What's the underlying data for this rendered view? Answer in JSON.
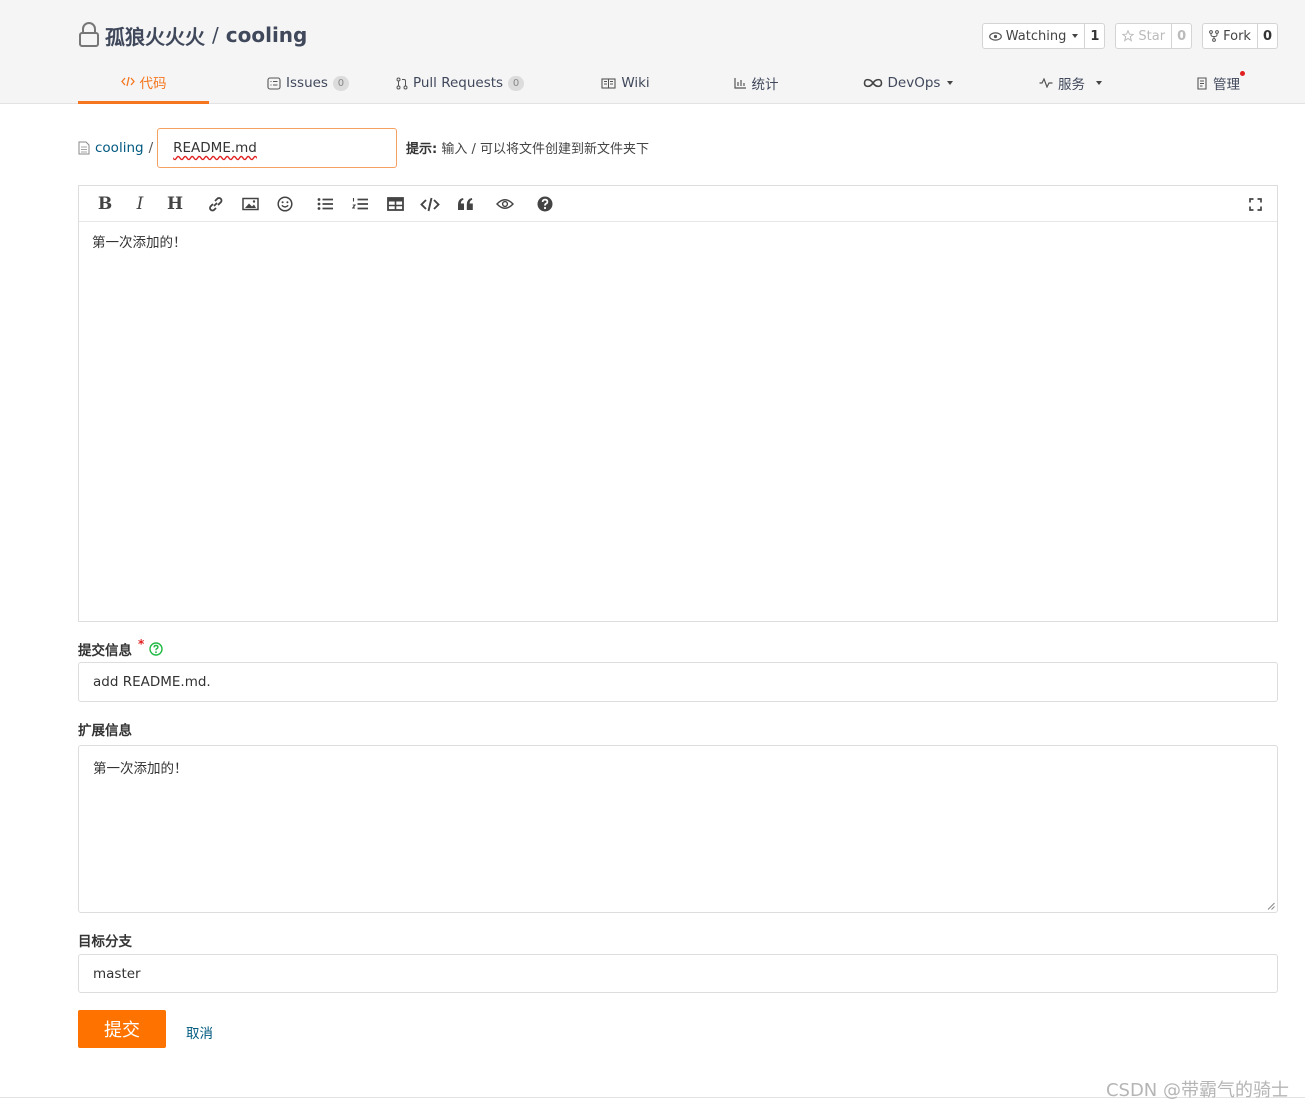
{
  "repo": {
    "owner": "孤狼火火火",
    "separator": "/",
    "name": "cooling"
  },
  "repo_actions": {
    "watching": {
      "label": "Watching",
      "count": "1"
    },
    "star": {
      "label": "Star",
      "count": "0"
    },
    "fork": {
      "label": "Fork",
      "count": "0"
    }
  },
  "tabs": [
    {
      "label": "代码",
      "active": true
    },
    {
      "label": "Issues",
      "badge": "0"
    },
    {
      "label": "Pull Requests",
      "badge": "0"
    },
    {
      "label": "Wiki"
    },
    {
      "label": "统计"
    },
    {
      "label": "DevOps"
    },
    {
      "label": "服务"
    },
    {
      "label": "管理"
    }
  ],
  "path": {
    "repo_link": "cooling",
    "slash": "/",
    "filename": "README.md"
  },
  "hint": {
    "label": "提示:",
    "text": "输入 / 可以将文件创建到新文件夹下"
  },
  "toolbar": [
    "bold-icon",
    "italic-icon",
    "heading-icon",
    "link-icon",
    "image-icon",
    "emoji-icon",
    "bullet-list-icon",
    "numbered-list-icon",
    "table-icon",
    "code-icon",
    "quote-icon",
    "preview-icon",
    "help-icon",
    "fullscreen-icon"
  ],
  "editor": {
    "content": "第一次添加的！"
  },
  "commit_message": {
    "label": "提交信息",
    "required_mark": "*",
    "value": "add README.md."
  },
  "extended_message": {
    "label": "扩展信息",
    "value": "第一次添加的！"
  },
  "target_branch": {
    "label": "目标分支",
    "value": "master"
  },
  "actions": {
    "submit": "提交",
    "cancel": "取消"
  },
  "watermark": "CSDN @带霸气的骑士",
  "colors": {
    "accent": "#fe7300",
    "link": "#005980",
    "required": "#e02020",
    "help": "#21ba45"
  }
}
